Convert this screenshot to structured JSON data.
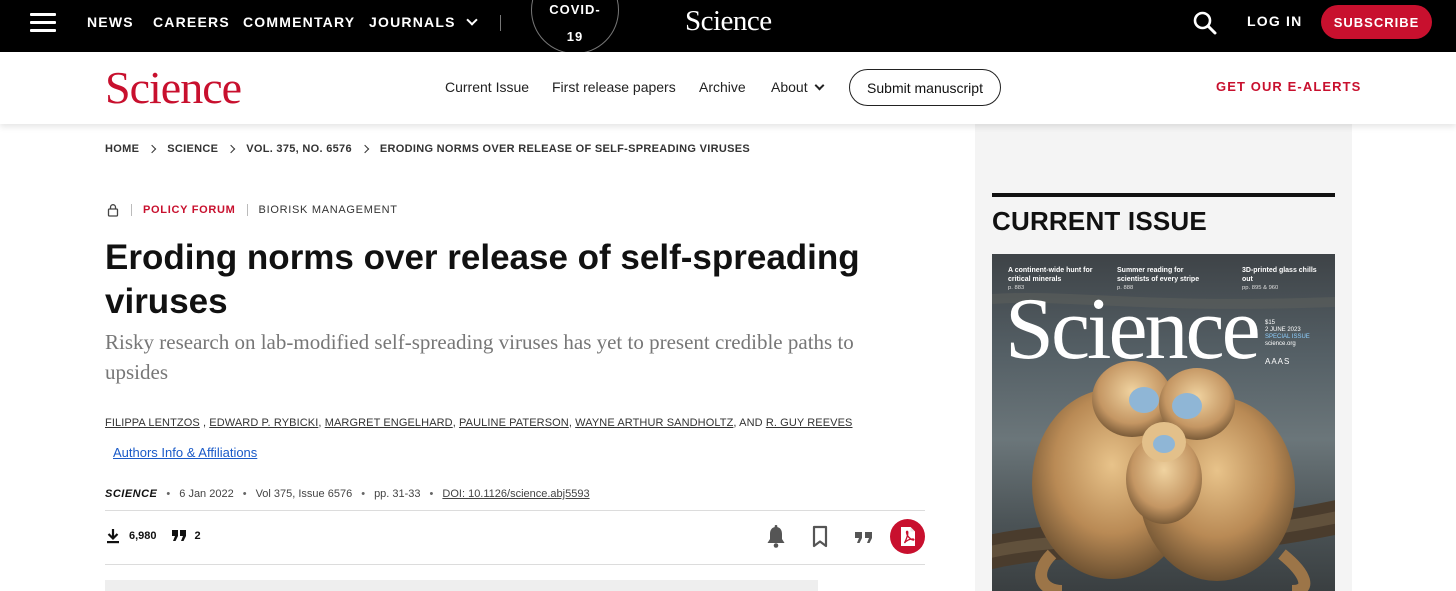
{
  "topbar": {
    "nav": [
      "NEWS",
      "CAREERS",
      "COMMENTARY",
      "JOURNALS"
    ],
    "covid_line1": "COVID-",
    "covid_line2": "19",
    "logo": "Science",
    "login": "LOG IN",
    "subscribe": "SUBSCRIBE"
  },
  "secondary_nav": {
    "logo": "Science",
    "links": [
      "Current Issue",
      "First release papers",
      "Archive",
      "About"
    ],
    "submit": "Submit manuscript",
    "alerts": "GET OUR E-ALERTS"
  },
  "breadcrumb": [
    "HOME",
    "SCIENCE",
    "VOL. 375, NO. 6576",
    "ERODING NORMS OVER RELEASE OF SELF-SPREADING VIRUSES"
  ],
  "article": {
    "category": "POLICY FORUM",
    "topic": "BIORISK MANAGEMENT",
    "title": "Eroding norms over release of self-spreading viruses",
    "subtitle": "Risky research on lab-modified self-spreading viruses has yet to present credible paths to upsides",
    "authors": [
      "FILIPPA LENTZOS",
      "EDWARD P. RYBICKI",
      "MARGRET ENGELHARD",
      "PAULINE PATERSON",
      "WAYNE ARTHUR SANDHOLTZ",
      "R. GUY REEVES"
    ],
    "authors_info": "Authors Info & Affiliations",
    "journal": "SCIENCE",
    "date": "6 Jan 2022",
    "volume": "Vol 375, Issue 6576",
    "pages": "pp. 31-33",
    "doi": "DOI: 10.1126/science.abj5593",
    "downloads": "6,980",
    "citations": "2"
  },
  "current_issue": {
    "heading": "CURRENT ISSUE",
    "cover_teasers": [
      {
        "text": "A continent-wide hunt for critical minerals",
        "page": "p. 883"
      },
      {
        "text": "Summer reading for scientists of every stripe",
        "page": "p. 888"
      },
      {
        "text": "3D-printed glass chills out",
        "page": "pp. 895 & 960"
      }
    ],
    "cover_logo": "Science",
    "cover_price": "$15",
    "cover_date": "2 JUNE 2023",
    "cover_special": "SPECIAL ISSUE",
    "cover_url": "science.org",
    "cover_publisher": "AAAS"
  },
  "colors": {
    "brand_red": "#c8102e",
    "link_blue": "#1a5ac8",
    "topbar": "#000000"
  },
  "icons": [
    "menu-icon",
    "search-icon",
    "lock-icon",
    "download-icon",
    "quote-icon",
    "bell-icon",
    "bookmark-icon",
    "pdf-icon"
  ]
}
